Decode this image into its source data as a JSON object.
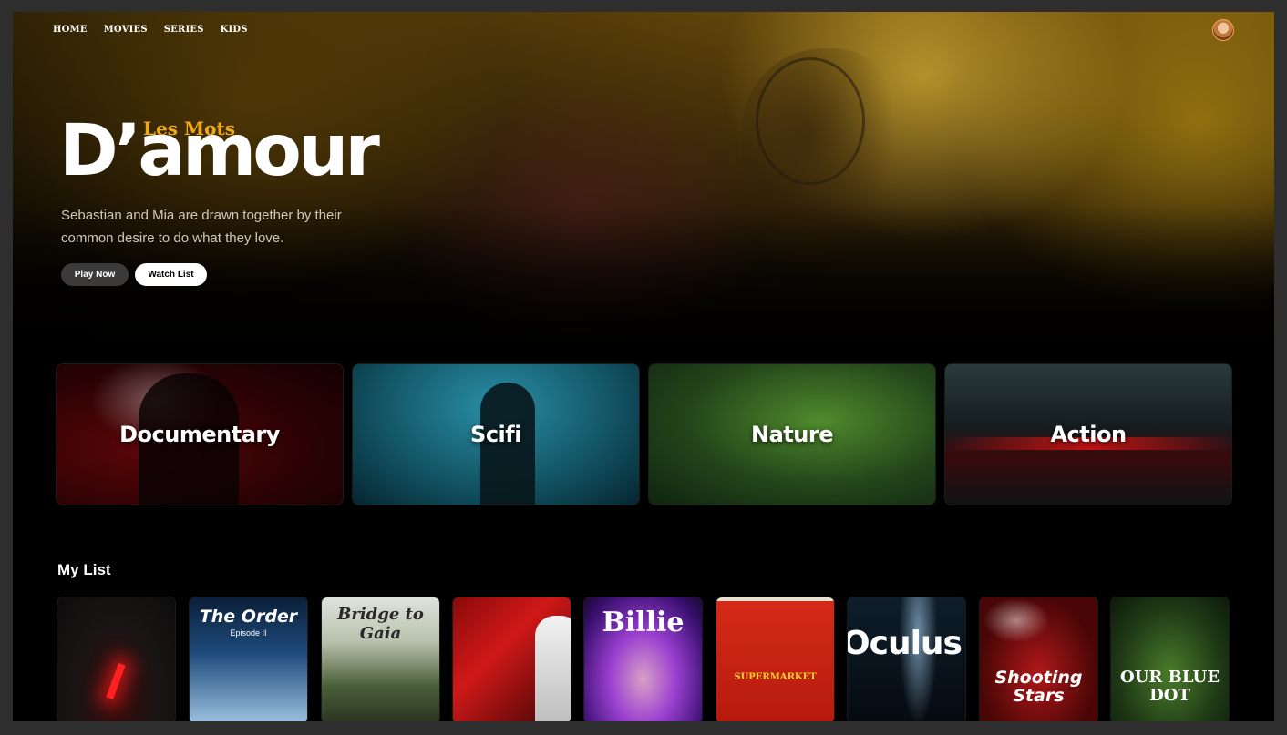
{
  "nav": {
    "items": [
      "HOME",
      "MOVIES",
      "SERIES",
      "KIDS"
    ],
    "avatar_icon": "user-avatar"
  },
  "hero": {
    "subtitle": "Les Mots",
    "title": "D’amour",
    "description": "Sebastian and Mia are drawn together by their common desire to do what they love.",
    "play_label": "Play Now",
    "watchlist_label": "Watch List",
    "accent_color": "#f0a818"
  },
  "genres": [
    "Documentary",
    "Scifi",
    "Nature",
    "Action"
  ],
  "my_list": {
    "title": "My List",
    "cards": [
      {
        "title": ""
      },
      {
        "title": "The Order",
        "subtitle": "Episode II"
      },
      {
        "title": "Bridge to Gaia"
      },
      {
        "title": ""
      },
      {
        "title": "Billie"
      },
      {
        "title": "SUPERMARKET"
      },
      {
        "title": "Oculus"
      },
      {
        "title": "Shooting Stars"
      },
      {
        "title": "OUR BLUE DOT"
      }
    ]
  }
}
